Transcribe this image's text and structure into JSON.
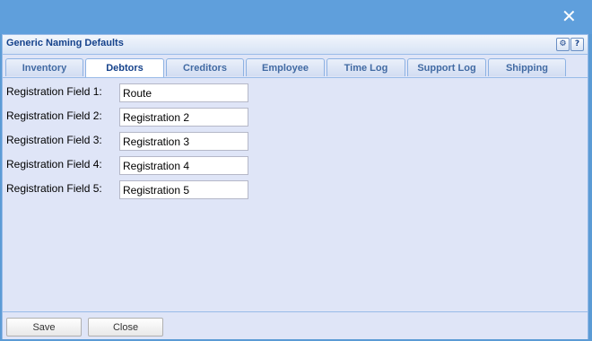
{
  "window": {
    "title": "Generic Naming Defaults",
    "close_glyph": "✕",
    "tools": {
      "gear_glyph": "⚙",
      "help_glyph": "?"
    }
  },
  "tabs": [
    {
      "label": "Inventory",
      "active": false
    },
    {
      "label": "Debtors",
      "active": true
    },
    {
      "label": "Creditors",
      "active": false
    },
    {
      "label": "Employee",
      "active": false
    },
    {
      "label": "Time Log",
      "active": false
    },
    {
      "label": "Support Log",
      "active": false
    },
    {
      "label": "Shipping",
      "active": false
    }
  ],
  "fields": [
    {
      "label": "Registration Field 1:",
      "value": "Route"
    },
    {
      "label": "Registration Field 2:",
      "value": "Registration 2"
    },
    {
      "label": "Registration Field 3:",
      "value": "Registration 3"
    },
    {
      "label": "Registration Field 4:",
      "value": "Registration 4"
    },
    {
      "label": "Registration Field 5:",
      "value": "Registration 5"
    }
  ],
  "footer": {
    "save_label": "Save",
    "close_label": "Close"
  },
  "colors": {
    "accent": "#15428b",
    "background": "#dfe5f7",
    "topbar": "#5f9fdc"
  }
}
